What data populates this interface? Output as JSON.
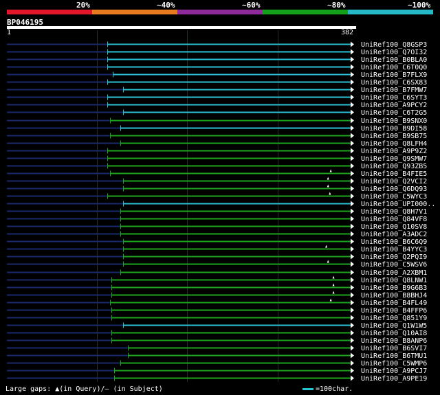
{
  "legend": {
    "labels": [
      "20%",
      "~40%",
      "~60%",
      "~80%",
      "~100%"
    ],
    "colors": [
      "#e4162b",
      "#e87a1f",
      "#8e2a9a",
      "#15a01b",
      "#25b9c8"
    ]
  },
  "query": {
    "id": "BP046195",
    "start": "1",
    "end": "382",
    "length": 382
  },
  "hits": [
    {
      "name": "UniRef100_Q8GSP3",
      "start": 112,
      "end": 382,
      "color": "#2bc1d4",
      "ticks": []
    },
    {
      "name": "UniRef100_Q7OI32",
      "start": 112,
      "end": 382,
      "color": "#2bc1d4",
      "ticks": []
    },
    {
      "name": "UniRef100_B0BLA0",
      "start": 112,
      "end": 382,
      "color": "#2bc1d4",
      "ticks": []
    },
    {
      "name": "UniRef100_C6T0Q0",
      "start": 112,
      "end": 382,
      "color": "#2bc1d4",
      "ticks": []
    },
    {
      "name": "UniRef100_B7FLX9",
      "start": 118,
      "end": 382,
      "color": "#2bc1d4",
      "ticks": []
    },
    {
      "name": "UniRef100_C6SX83",
      "start": 112,
      "end": 382,
      "color": "#2bc1d4",
      "ticks": []
    },
    {
      "name": "UniRef100_B7FMW7",
      "start": 130,
      "end": 382,
      "color": "#2bc1d4",
      "ticks": []
    },
    {
      "name": "UniRef100_C6SYT3",
      "start": 112,
      "end": 382,
      "color": "#2bc1d4",
      "ticks": []
    },
    {
      "name": "UniRef100_A9PCY2",
      "start": 112,
      "end": 382,
      "color": "#2bc1d4",
      "ticks": []
    },
    {
      "name": "UniRef100_C6T2G5",
      "start": 130,
      "end": 382,
      "color": "#2bc1d4",
      "ticks": []
    },
    {
      "name": "UniRef100_B9SNX0",
      "start": 115,
      "end": 382,
      "color": "#1ea51e",
      "ticks": []
    },
    {
      "name": "UniRef100_B9DI58",
      "start": 127,
      "end": 382,
      "color": "#2bc1d4",
      "ticks": []
    },
    {
      "name": "UniRef100_B9SB75",
      "start": 115,
      "end": 382,
      "color": "#1ea51e",
      "ticks": []
    },
    {
      "name": "UniRef100_Q8LFH4",
      "start": 127,
      "end": 382,
      "color": "#1ea51e",
      "ticks": []
    },
    {
      "name": "UniRef100_A9P9Z2",
      "start": 112,
      "end": 382,
      "color": "#1ea51e",
      "ticks": []
    },
    {
      "name": "UniRef100_Q9SMW7",
      "start": 112,
      "end": 382,
      "color": "#1ea51e",
      "ticks": []
    },
    {
      "name": "UniRef100_Q93ZB5",
      "start": 112,
      "end": 382,
      "color": "#1ea51e",
      "ticks": []
    },
    {
      "name": "UniRef100_B4FIE5",
      "start": 115,
      "end": 382,
      "color": "#1ea51e",
      "ticks": [
        360
      ]
    },
    {
      "name": "UniRef100_Q2VCI2",
      "start": 130,
      "end": 382,
      "color": "#1ea51e",
      "ticks": [
        357
      ]
    },
    {
      "name": "UniRef100_Q6DQ93",
      "start": 130,
      "end": 382,
      "color": "#1ea51e",
      "ticks": [
        357
      ]
    },
    {
      "name": "UniRef100_C5WYC3",
      "start": 112,
      "end": 382,
      "color": "#1ea51e",
      "ticks": [
        359
      ]
    },
    {
      "name": "UniRef100_UPI000..",
      "start": 130,
      "end": 382,
      "color": "#2bc1d4",
      "ticks": []
    },
    {
      "name": "UniRef100_Q8H7V1",
      "start": 127,
      "end": 382,
      "color": "#1ea51e",
      "ticks": []
    },
    {
      "name": "UniRef100_Q84VF8",
      "start": 127,
      "end": 382,
      "color": "#1ea51e",
      "ticks": []
    },
    {
      "name": "UniRef100_Q10SV8",
      "start": 127,
      "end": 382,
      "color": "#1ea51e",
      "ticks": []
    },
    {
      "name": "UniRef100_A3ADC2",
      "start": 127,
      "end": 382,
      "color": "#1ea51e",
      "ticks": []
    },
    {
      "name": "UniRef100_B6C6Q9",
      "start": 130,
      "end": 382,
      "color": "#1ea51e",
      "ticks": []
    },
    {
      "name": "UniRef100_B4YYC3",
      "start": 130,
      "end": 382,
      "color": "#1ea51e",
      "ticks": [
        355
      ]
    },
    {
      "name": "UniRef100_Q2PQI9",
      "start": 130,
      "end": 382,
      "color": "#1ea51e",
      "ticks": []
    },
    {
      "name": "UniRef100_C5WSV6",
      "start": 130,
      "end": 382,
      "color": "#1ea51e",
      "ticks": [
        357
      ]
    },
    {
      "name": "UniRef100_A2XBM1",
      "start": 127,
      "end": 382,
      "color": "#1ea51e",
      "ticks": []
    },
    {
      "name": "UniRef100_Q8LNW1",
      "start": 117,
      "end": 382,
      "color": "#1ea51e",
      "ticks": [
        363
      ]
    },
    {
      "name": "UniRef100_B9G6B3",
      "start": 117,
      "end": 382,
      "color": "#1ea51e",
      "ticks": [
        363
      ]
    },
    {
      "name": "UniRef100_B8BHJ4",
      "start": 117,
      "end": 382,
      "color": "#1ea51e",
      "ticks": [
        363
      ]
    },
    {
      "name": "UniRef100_B4FL49",
      "start": 115,
      "end": 382,
      "color": "#1ea51e",
      "ticks": [
        360
      ]
    },
    {
      "name": "UniRef100_B4FFP6",
      "start": 117,
      "end": 382,
      "color": "#1ea51e",
      "ticks": []
    },
    {
      "name": "UniRef100_Q851Y9",
      "start": 117,
      "end": 382,
      "color": "#1ea51e",
      "ticks": []
    },
    {
      "name": "UniRef100_Q1W1W5",
      "start": 130,
      "end": 382,
      "color": "#2bc1d4",
      "ticks": []
    },
    {
      "name": "UniRef100_Q10AI8",
      "start": 117,
      "end": 382,
      "color": "#1ea51e",
      "ticks": []
    },
    {
      "name": "UniRef100_B8ANP6",
      "start": 117,
      "end": 382,
      "color": "#1ea51e",
      "ticks": []
    },
    {
      "name": "UniRef100_B6SVI7",
      "start": 135,
      "end": 382,
      "color": "#1ea51e",
      "ticks": []
    },
    {
      "name": "UniRef100_B6TMU1",
      "start": 135,
      "end": 382,
      "color": "#1ea51e",
      "ticks": []
    },
    {
      "name": "UniRef100_C5WMP6",
      "start": 127,
      "end": 382,
      "color": "#1ea51e",
      "ticks": []
    },
    {
      "name": "UniRef100_A9PCJ7",
      "start": 120,
      "end": 382,
      "color": "#1ea51e",
      "ticks": []
    },
    {
      "name": "UniRef100_A9PE19",
      "start": 120,
      "end": 382,
      "color": "#1ea51e",
      "ticks": []
    }
  ],
  "footer": {
    "text": "Large gaps: ▲(in Query)/— (in Subject)",
    "scale": "=100char."
  }
}
